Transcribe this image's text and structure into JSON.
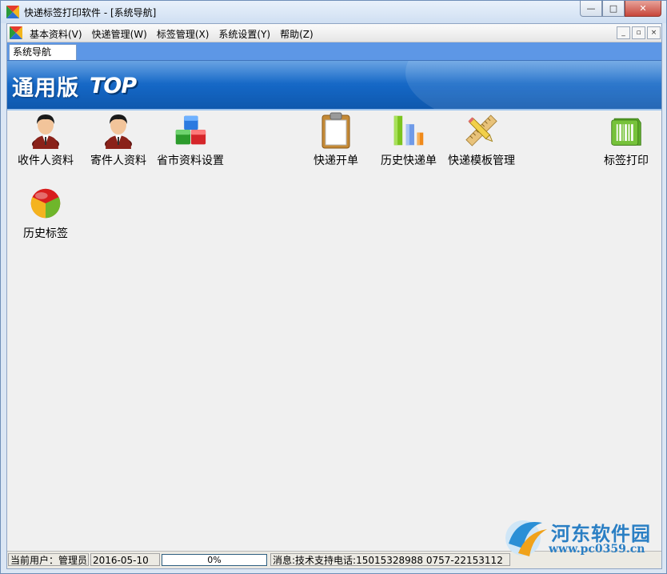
{
  "window": {
    "title": "快递标签打印软件 - [系统导航]",
    "controls": {
      "minimize": "—",
      "maximize": "□",
      "close": "✕"
    }
  },
  "menubar": {
    "items": [
      "基本资料(V)",
      "快递管理(W)",
      "标签管理(X)",
      "系统设置(Y)",
      "帮助(Z)"
    ],
    "mdi_controls": {
      "minimize": "_",
      "restore": "▫",
      "close": "×"
    }
  },
  "tabs": [
    "系统导航"
  ],
  "banner": {
    "title": "通用版",
    "badge": "TOP"
  },
  "nav_icons": [
    {
      "label": "收件人资料",
      "icon": "person-icon"
    },
    {
      "label": "寄件人资料",
      "icon": "person-icon"
    },
    {
      "label": "省市资料设置",
      "icon": "blocks-icon"
    },
    {
      "label": "快递开单",
      "icon": "clipboard-icon"
    },
    {
      "label": "历史快递单",
      "icon": "bar-chart-icon"
    },
    {
      "label": "快递模板管理",
      "icon": "ruler-pencil-icon"
    },
    {
      "label": "标签打印",
      "icon": "barcode-icon"
    },
    {
      "label": "历史标签",
      "icon": "pie-chart-icon"
    }
  ],
  "statusbar": {
    "current_user": "当前用户：管理员",
    "date": "2016-05-10",
    "progress": {
      "value": 0,
      "text": "0%"
    },
    "message": "消息:技术支持电话:15015328988 0757-22153112"
  },
  "watermark": {
    "title": "河东软件园",
    "url": "www.pc0359.cn"
  },
  "colors": {
    "banner": "#1466c4",
    "tabstrip": "#5d97e6",
    "workspace": "#f0f0f0"
  }
}
